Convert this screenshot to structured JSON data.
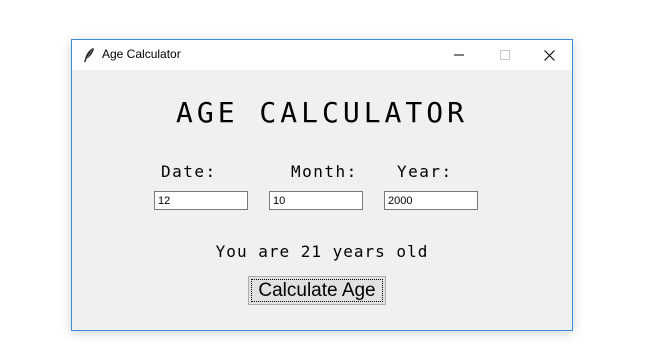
{
  "window": {
    "title": "Age Calculator",
    "controls": {
      "minimize": "minimize-icon",
      "maximize": "maximize-icon",
      "close": "close-icon"
    },
    "accent_border": "#3c8cd6"
  },
  "app": {
    "heading": "AGE CALCULATOR",
    "labels": {
      "date": "Date:",
      "month": "Month:",
      "year": "Year:"
    },
    "inputs": {
      "date": "12",
      "month": "10",
      "year": "2000"
    },
    "result": "You are 21 years old",
    "button_label": "Calculate Age"
  }
}
